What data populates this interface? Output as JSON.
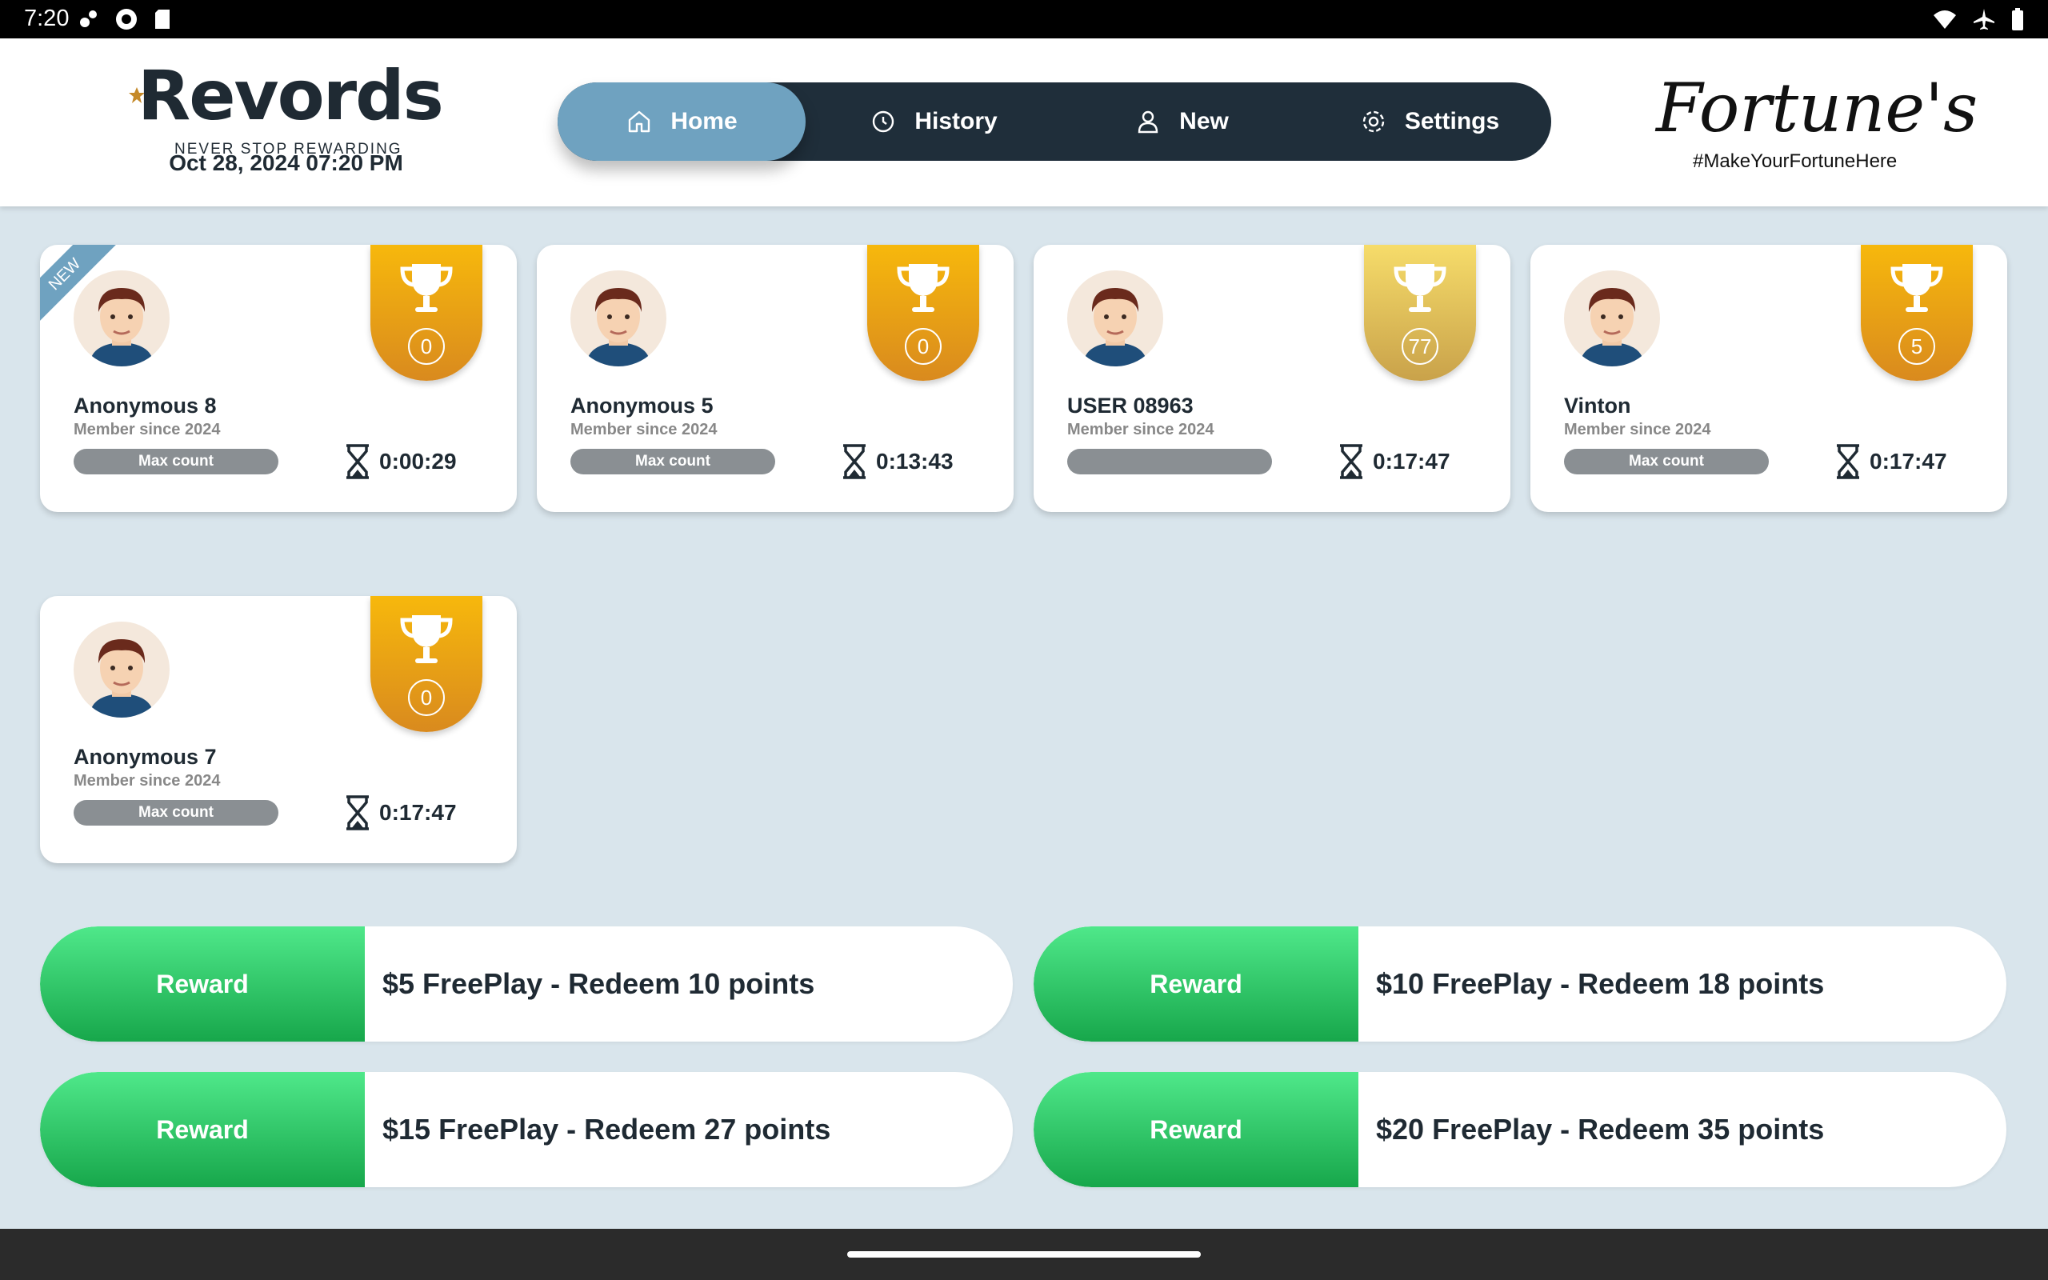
{
  "status_bar": {
    "time": "7:20"
  },
  "header": {
    "logo_text": "Revords",
    "logo_tagline": "NEVER STOP REWARDING",
    "datetime": "Oct 28, 2024 07:20 PM",
    "brand_name": "Fortune's",
    "brand_hashtag": "#MakeYourFortuneHere"
  },
  "nav": {
    "items": [
      {
        "label": "Home",
        "icon": "home-icon",
        "active": true
      },
      {
        "label": "History",
        "icon": "history-icon",
        "active": false
      },
      {
        "label": "New",
        "icon": "user-icon",
        "active": false
      },
      {
        "label": "Settings",
        "icon": "gear-icon",
        "active": false
      }
    ]
  },
  "members": [
    {
      "name": "Anonymous 8",
      "since": "Member since 2024",
      "badge": "Max count",
      "timer": "0:00:29",
      "trophy_count": "0",
      "new": true,
      "new_label": "NEW"
    },
    {
      "name": "Anonymous 5",
      "since": "Member since 2024",
      "badge": "Max count",
      "timer": "0:13:43",
      "trophy_count": "0"
    },
    {
      "name": "USER 08963",
      "since": "Member since 2024",
      "badge": "",
      "timer": "0:17:47",
      "trophy_count": "77"
    },
    {
      "name": "Vinton",
      "since": "Member since 2024",
      "badge": "Max count",
      "timer": "0:17:47",
      "trophy_count": "5"
    },
    {
      "name": "Anonymous 7",
      "since": "Member since 2024",
      "badge": "Max count",
      "timer": "0:17:47",
      "trophy_count": "0"
    }
  ],
  "rewards": [
    {
      "button": "Reward",
      "text": "$5 FreePlay - Redeem 10 points"
    },
    {
      "button": "Reward",
      "text": "$10 FreePlay - Redeem 18 points"
    },
    {
      "button": "Reward",
      "text": "$15 FreePlay - Redeem 27 points"
    },
    {
      "button": "Reward",
      "text": "$20 FreePlay - Redeem 35 points"
    }
  ],
  "colors": {
    "background": "#d9e5ec",
    "nav_dark": "#1f2e3a",
    "nav_active": "#6fa2c0",
    "trophy_orange": "#f7b80c",
    "reward_green": "#2fcf6a"
  }
}
